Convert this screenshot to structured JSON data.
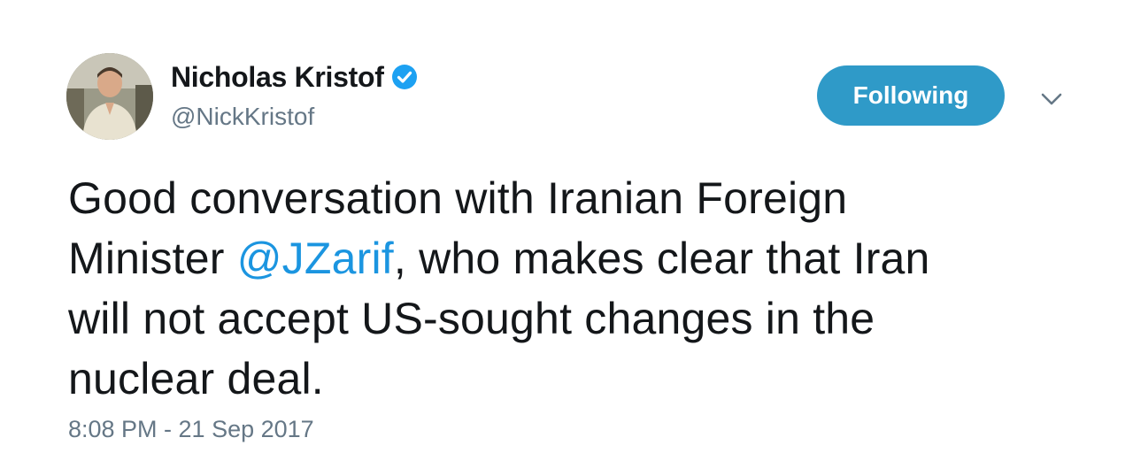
{
  "author": {
    "display_name": "Nicholas Kristof",
    "handle": "@NickKristof",
    "verified_icon": "verified-badge-icon",
    "avatar_icon": "user-avatar"
  },
  "actions": {
    "follow_label": "Following",
    "menu_icon": "chevron-down-icon"
  },
  "tweet": {
    "line1": "Good conversation with Iranian Foreign",
    "line2_before": "Minister ",
    "mention": "@JZarif",
    "line2_after": ", who makes clear that Iran",
    "line3": "will not accept US-sought changes in the",
    "line4": "nuclear deal.",
    "timestamp": "8:08 PM - 21 Sep 2017"
  },
  "colors": {
    "accent": "#2f9ac8",
    "link": "#1b95e0",
    "secondary_text": "#657786",
    "primary_text": "#14171a"
  }
}
